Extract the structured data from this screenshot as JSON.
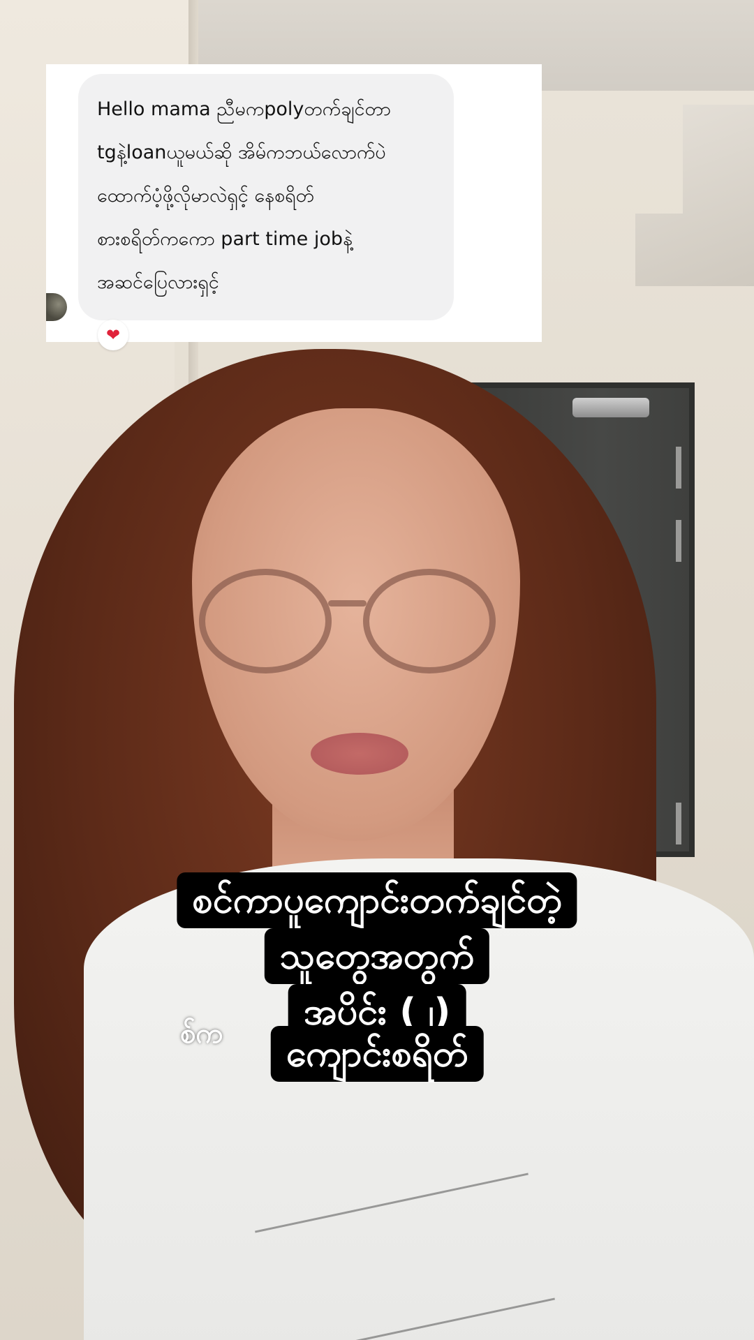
{
  "comment": {
    "lines": [
      "Hello mama ညီမကpolyတက်ချင်တာ",
      "tgနဲ့loanယူမယ်ဆို အိမ်ကဘယ်လောက်ပဲ",
      "ထောက်ပံ့ဖို့လိုမာလဲရှင့် နေစရိတ်",
      "စားစရိတ်ကကော part time jobနဲ့",
      "အဆင်ပြေလားရှင့်"
    ],
    "reaction": "❤"
  },
  "caption": {
    "lines": [
      "စင်ကာပူကျောင်းတက်ချင်တဲ့",
      "သူတွေအတွက်",
      "အပိုင်း (၂)",
      "ကျောင်းစရိတ်"
    ],
    "partial_overlay": "စ်က"
  },
  "colors": {
    "caption_bg": "#000000",
    "caption_text": "#ffffff",
    "bubble_bg": "#f1f1f2",
    "card_bg": "#ffffff",
    "reaction": "#e0223a"
  }
}
